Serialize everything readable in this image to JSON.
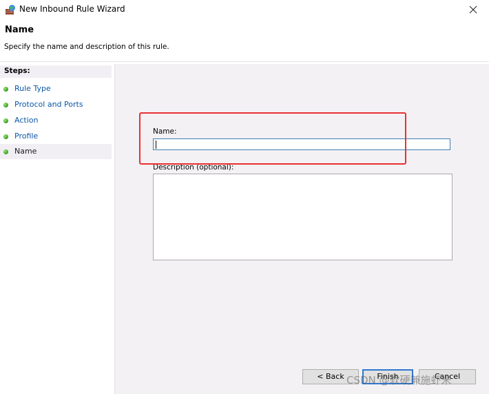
{
  "window": {
    "title": "New Inbound Rule Wizard",
    "icon": "firewall-icon",
    "close_glyph": "✕"
  },
  "header": {
    "title": "Name",
    "subtitle": "Specify the name and description of this rule."
  },
  "sidebar": {
    "heading": "Steps:",
    "items": [
      {
        "label": "Rule Type"
      },
      {
        "label": "Protocol and Ports"
      },
      {
        "label": "Action"
      },
      {
        "label": "Profile"
      },
      {
        "label": "Name"
      }
    ]
  },
  "form": {
    "name_label": "Name:",
    "name_value": "",
    "description_label": "Description (optional):",
    "description_value": ""
  },
  "buttons": {
    "back": "< Back",
    "finish": "Finish",
    "cancel": "Cancel"
  },
  "watermark": "CSDN @软硬兼施虾米",
  "colors": {
    "highlight": "#e8302f",
    "link": "#0b57a7",
    "focus_border": "#2f78d1",
    "content_bg": "#f4f1f5"
  }
}
